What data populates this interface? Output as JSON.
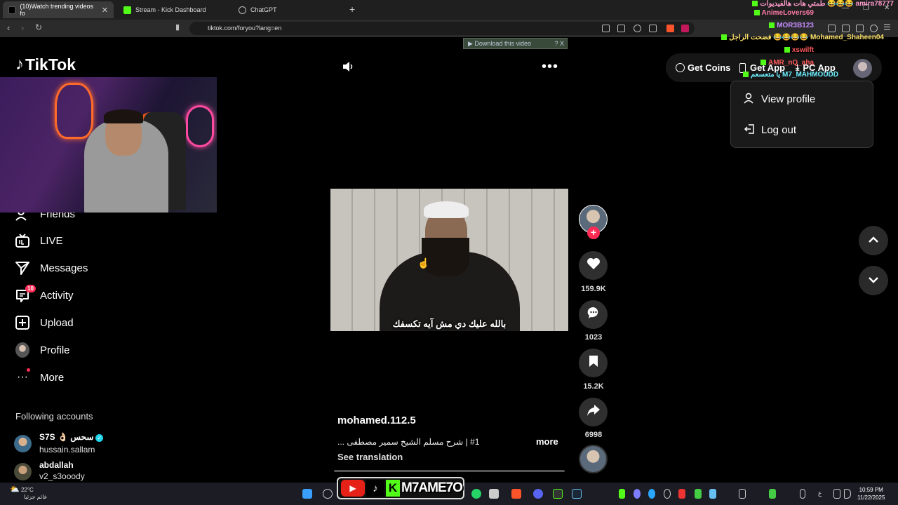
{
  "browser": {
    "tabs": [
      {
        "label": "(10)Watch trending videos fo",
        "active": true,
        "icon": "tiktok-icon"
      },
      {
        "label": "Stream - Kick Dashboard",
        "active": false,
        "icon": "kick-icon"
      },
      {
        "label": "ChatGPT",
        "active": false,
        "icon": "chatgpt-icon"
      }
    ],
    "url": "tiktok.com/foryou?lang=en",
    "download_bar": "▶ Download this video",
    "download_bar_help": "? X"
  },
  "tiktok": {
    "logo": "TikTok",
    "nav": [
      {
        "label": "Friends",
        "icon": "friends-icon"
      },
      {
        "label": "LIVE",
        "icon": "live-icon"
      },
      {
        "label": "Messages",
        "icon": "messages-icon"
      },
      {
        "label": "Activity",
        "icon": "activity-icon",
        "badge": "10"
      },
      {
        "label": "Upload",
        "icon": "upload-icon"
      },
      {
        "label": "Profile",
        "icon": "profile-avatar"
      },
      {
        "label": "More",
        "icon": "more-icon"
      }
    ],
    "following_title": "Following accounts",
    "following": [
      {
        "name": "S7S 👌🏻 سحس",
        "username": "hussain.sallam",
        "verified": true
      },
      {
        "name": "abdallah",
        "username": "v2_s3ooody",
        "verified": false
      }
    ],
    "header": {
      "get_coins": "Get Coins",
      "get_app": "Get App",
      "pc_app": "PC App"
    },
    "profile_menu": {
      "view_profile": "View profile",
      "log_out": "Log out"
    },
    "video": {
      "subtitle": "بالله عليك دي مش آيه تكسفك",
      "author": "mohamed.112.5",
      "description": "#1 | شرح مسلم الشيخ سمير مصطفى ...",
      "more": "more",
      "see_translation": "See translation",
      "likes": "159.9K",
      "comments": "1023",
      "saves": "15.2K",
      "shares": "6998"
    }
  },
  "stream_chat": [
    "طمتي هات هالفيديوات 😂😂😂 amira78777",
    "AnimeLovers69",
    "MOR3B123",
    "فضحت الراجل 😂😂😂😂 Mohamed_Shaheen04",
    "xswilft",
    "AMR_nQ_aha",
    "يا متعسعم M7_MAHMOUDD"
  ],
  "stream_overlay": {
    "brand": "M7AME7O"
  },
  "taskbar": {
    "weather_temp": "22°C",
    "weather_desc": "غائم جزئيا",
    "time": "10:59 PM",
    "date": "11/22/2025",
    "lang": "ع"
  }
}
